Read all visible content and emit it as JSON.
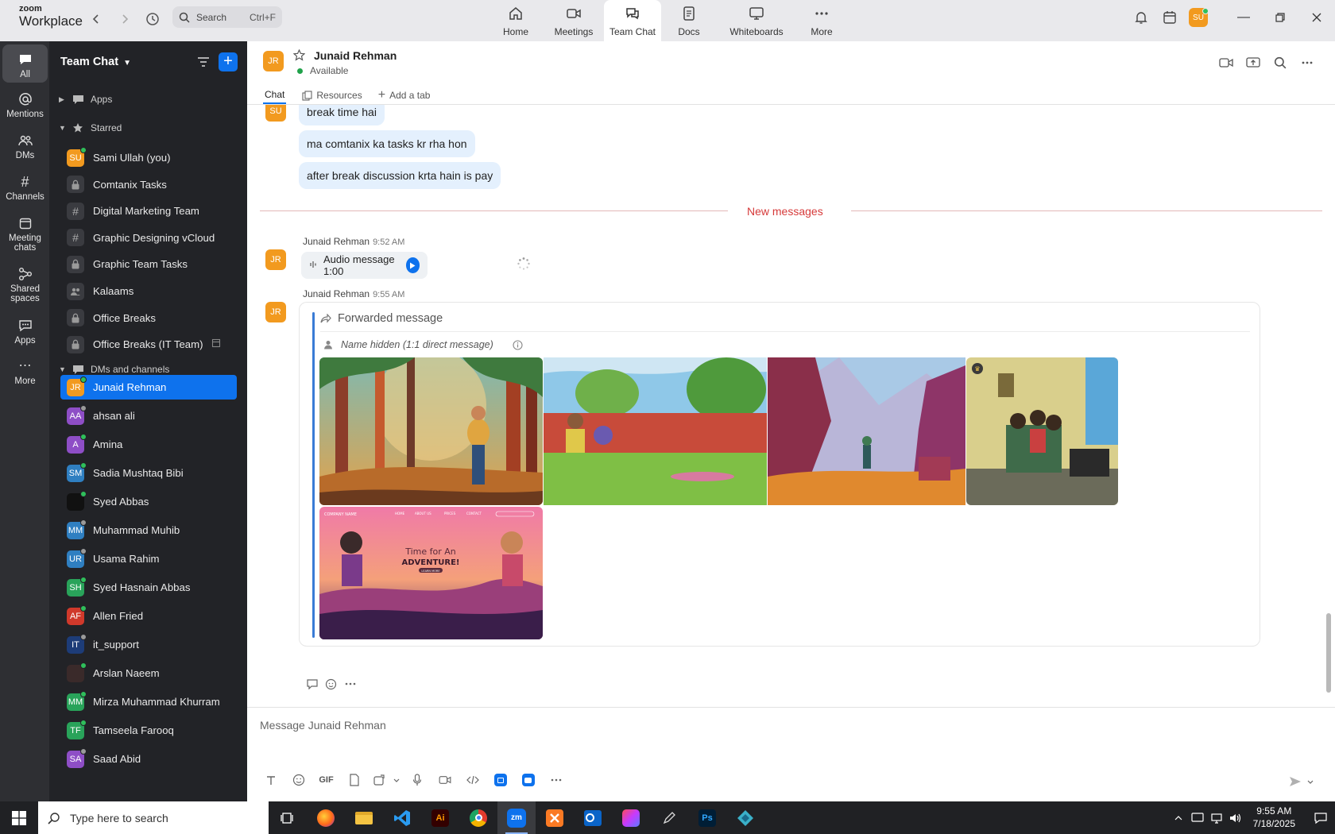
{
  "app": {
    "brand_top": "zoom",
    "brand_bottom": "Workplace",
    "search_placeholder": "Search",
    "search_shortcut": "Ctrl+F",
    "user_initials": "SU",
    "accent_color": "#0e72ed"
  },
  "tabs": [
    {
      "label": "Home",
      "icon": "home-icon"
    },
    {
      "label": "Meetings",
      "icon": "video-icon"
    },
    {
      "label": "Team Chat",
      "icon": "chat-icon",
      "active": true
    },
    {
      "label": "Docs",
      "icon": "doc-icon"
    },
    {
      "label": "Whiteboards",
      "icon": "whiteboard-icon"
    },
    {
      "label": "More",
      "icon": "more-icon"
    }
  ],
  "rail": [
    {
      "label": "All",
      "icon": "chat-bubble-icon",
      "active": true
    },
    {
      "label": "Mentions",
      "icon": "at-icon"
    },
    {
      "label": "DMs",
      "icon": "people-icon"
    },
    {
      "label": "Channels",
      "icon": "hash-icon"
    },
    {
      "label": "Meeting chats",
      "icon": "calendar-icon"
    },
    {
      "label": "Shared spaces",
      "icon": "share-icon"
    },
    {
      "label": "Apps",
      "icon": "apps-icon"
    },
    {
      "label": "More",
      "icon": "more-icon"
    }
  ],
  "sidebar": {
    "title": "Team Chat",
    "sections": {
      "apps": "Apps",
      "starred": "Starred",
      "dms": "DMs and channels"
    },
    "starred": [
      {
        "name": "Sami Ullah (you)",
        "initials": "SU",
        "color": "#f29a1f",
        "type": "user",
        "status": "#2fbf5b"
      },
      {
        "name": "Comtanix Tasks",
        "type": "lock"
      },
      {
        "name": "Digital Marketing Team",
        "type": "hash"
      },
      {
        "name": "Graphic Designing vCloud",
        "type": "hash"
      },
      {
        "name": "Graphic Team Tasks",
        "type": "lock"
      },
      {
        "name": "Kalaams",
        "type": "group"
      },
      {
        "name": "Office Breaks",
        "type": "lock"
      },
      {
        "name": "Office Breaks (IT Team)",
        "type": "lock"
      }
    ],
    "dms": [
      {
        "name": "Junaid Rehman",
        "initials": "JR",
        "color": "#f29a1f",
        "status": "#2fbf5b",
        "active": true
      },
      {
        "name": "ahsan ali",
        "initials": "AA",
        "color": "#8e4ec6",
        "status": "#9a9a9a"
      },
      {
        "name": "Amina",
        "initials": "A",
        "color": "#8e4ec6",
        "status": "#2fbf5b"
      },
      {
        "name": "Sadia Mushtaq Bibi",
        "initials": "SM",
        "color": "#2f7fc1",
        "status": "#2fbf5b"
      },
      {
        "name": "Syed Abbas",
        "initials": "",
        "color": "#111111",
        "status": "#2fbf5b"
      },
      {
        "name": "Muhammad Muhib",
        "initials": "MM",
        "color": "#2f7fc1",
        "status": "#9a9a9a"
      },
      {
        "name": "Usama Rahim",
        "initials": "UR",
        "color": "#2f7fc1",
        "status": "#9a9a9a"
      },
      {
        "name": "Syed Hasnain Abbas",
        "initials": "SH",
        "color": "#29a35a",
        "status": "#2fbf5b"
      },
      {
        "name": "Allen Fried",
        "initials": "AF",
        "color": "#d0392b",
        "status": "#2fbf5b"
      },
      {
        "name": "it_support",
        "initials": "IT",
        "color": "#1d3c78",
        "status": "#9a9a9a"
      },
      {
        "name": "Arslan Naeem",
        "initials": "",
        "color": "#3a2a2a",
        "status": "#2fbf5b"
      },
      {
        "name": "Mirza Muhammad Khurram",
        "initials": "MM",
        "color": "#29a35a",
        "status": "#2fbf5b"
      },
      {
        "name": "Tamseela Farooq",
        "initials": "TF",
        "color": "#29a35a",
        "status": "#2fbf5b"
      },
      {
        "name": "Saad Abid",
        "initials": "SA",
        "color": "#8e4ec6",
        "status": "#9a9a9a"
      }
    ]
  },
  "chat": {
    "contact_name": "Junaid Rehman",
    "contact_initials": "JR",
    "contact_status": "Available",
    "tabs": [
      "Chat",
      "Resources",
      "Add a tab"
    ],
    "earlier_sender_initials": "SU",
    "earlier_messages": [
      "break time hai",
      "ma comtanix ka tasks kr rha hon",
      "after break discussion krta hain is pay"
    ],
    "new_messages_label": "New messages",
    "msg1": {
      "sender": "Junaid Rehman",
      "time": "9:52 AM",
      "audio_label": "Audio message 1:00"
    },
    "msg2": {
      "sender": "Junaid Rehman",
      "time": "9:55 AM",
      "forward_label": "Forwarded message",
      "from_label": "Name hidden (1:1 direct message)"
    },
    "composer_placeholder": "Message Junaid Rehman",
    "toolbar_gif": "GIF",
    "adventure_banner": {
      "company": "COMPANY NAME",
      "nav": [
        "HOME",
        "ABOUT US",
        "PRICES",
        "CONTACT"
      ],
      "line1": "Time for An",
      "line2": "ADVENTURE!",
      "button": "LEARN MORE"
    }
  },
  "taskbar": {
    "search_placeholder": "Type here to search",
    "time": "9:55 AM",
    "date": "7/18/2025"
  }
}
